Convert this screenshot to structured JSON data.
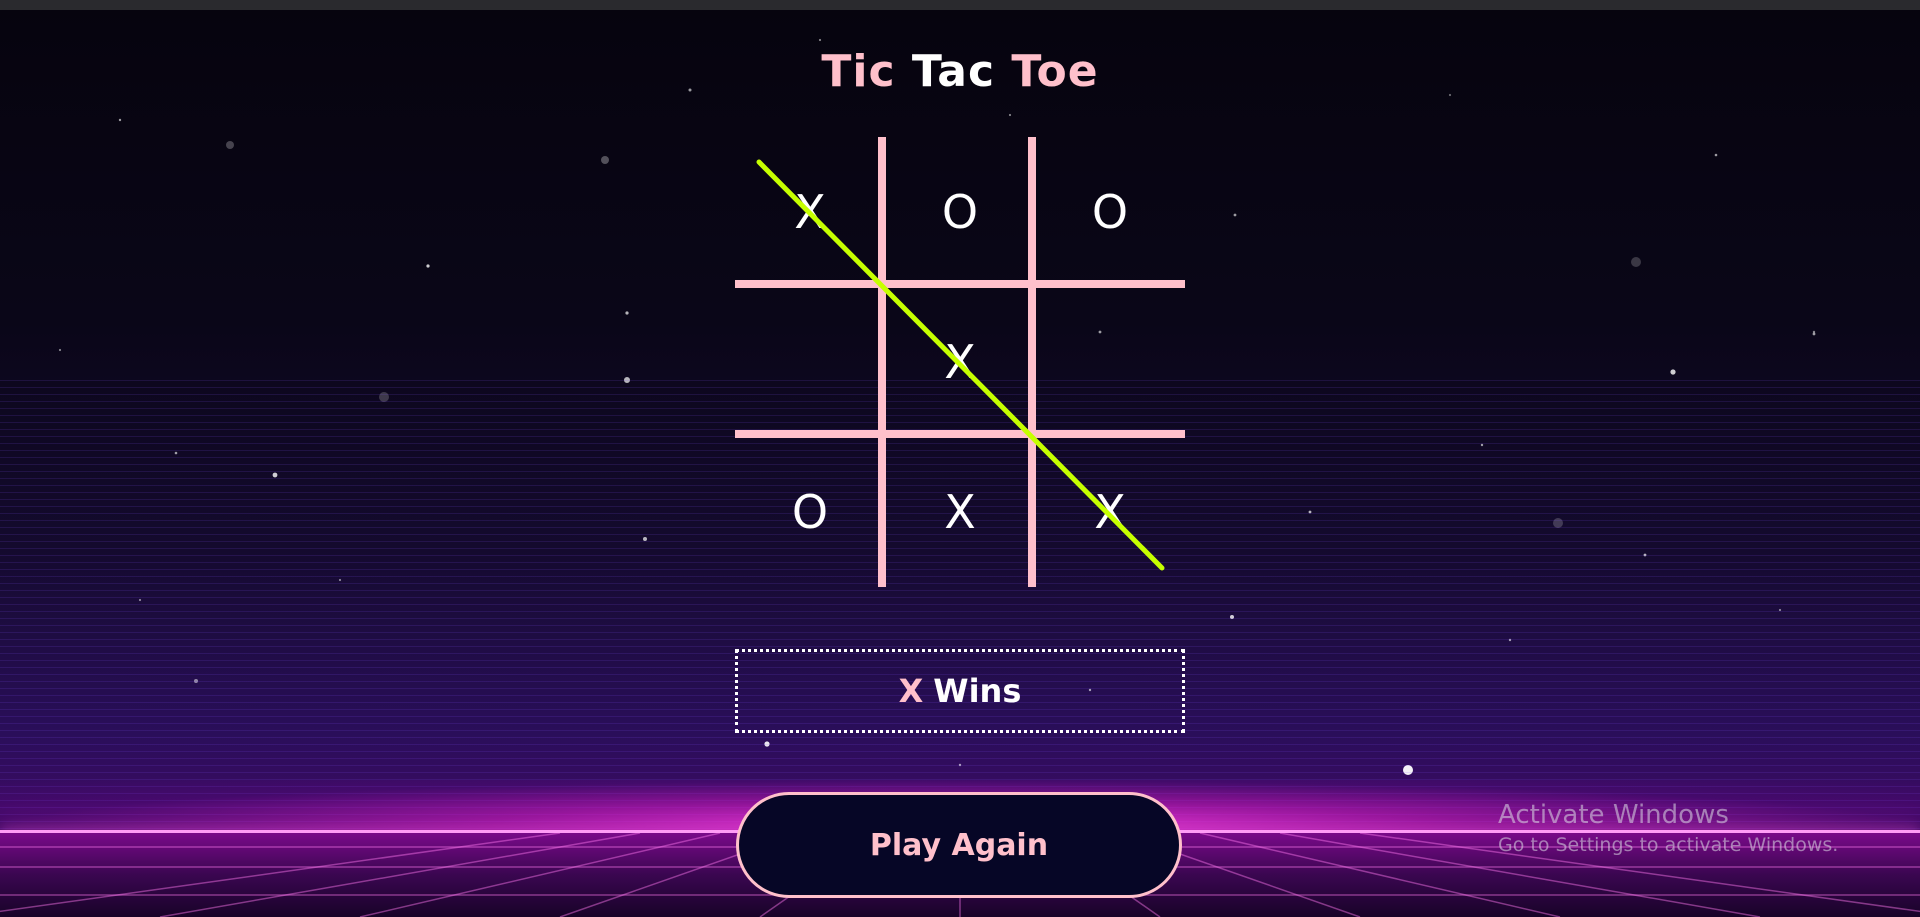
{
  "title": {
    "part1": "Tic",
    "part2": "Tac",
    "part3": "Toe"
  },
  "board": {
    "cells": [
      "X",
      "O",
      "O",
      "",
      "X",
      "",
      "O",
      "X",
      "X"
    ],
    "winning_line": "diagonal-top-left-to-bottom-right",
    "win_line_color": "#c6ff00",
    "grid_color": "#ffc0cb"
  },
  "status": {
    "winner": "X",
    "text": "Wins"
  },
  "play_again": {
    "label": "Play Again"
  },
  "watermark": {
    "title": "Activate Windows",
    "subtitle": "Go to Settings to activate Windows."
  },
  "colors": {
    "accent_pink": "#ffc0cb",
    "background": "#05030c",
    "neon_magenta": "#ff3ce0"
  }
}
